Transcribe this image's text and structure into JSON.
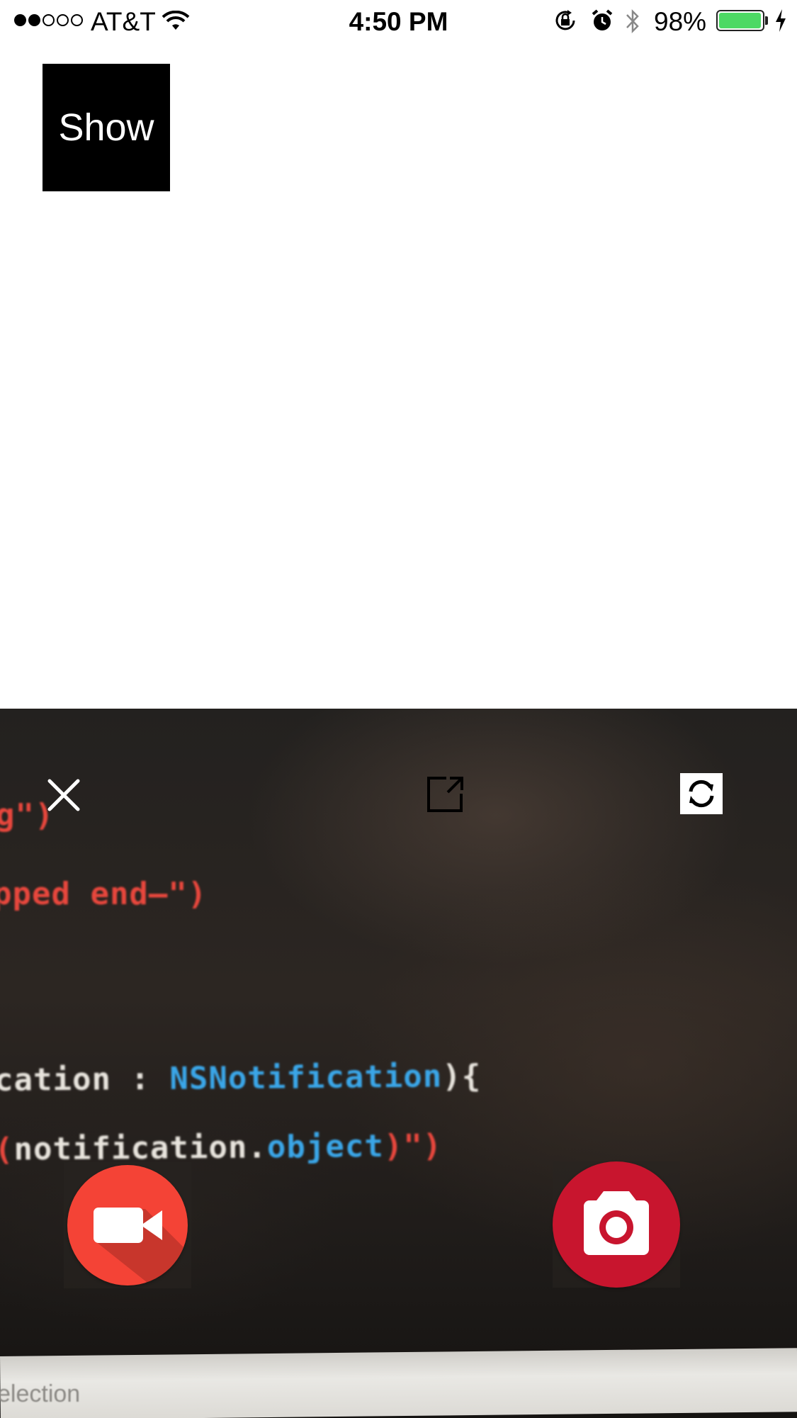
{
  "status_bar": {
    "carrier": "AT&T",
    "time": "4:50 PM",
    "battery_percent": "98%",
    "battery_level": 0.98,
    "signal_bars_filled": 2,
    "signal_bars_total": 5,
    "icons": [
      "signal-dots-icon",
      "wifi-icon",
      "rotation-lock-icon",
      "alarm-icon",
      "bluetooth-icon",
      "battery-icon",
      "charging-bolt-icon"
    ],
    "battery_color": "#4cd964"
  },
  "main": {
    "show_button_label": "Show"
  },
  "camera": {
    "controls": {
      "close_icon": "close-icon",
      "expand_icon": "expand-icon",
      "switch_icon": "switch-camera-icon",
      "video_icon": "video-camera-icon",
      "photo_icon": "photo-camera-icon"
    },
    "colors": {
      "video_button": "#f44336",
      "photo_button": "#c8152e"
    },
    "preview_text": {
      "line1": "g\")",
      "line2": "pped end—\")",
      "line3_a": "cation : ",
      "line3_b": "NSNotification",
      "line3_c": "){",
      "line4_a": "(",
      "line4_b": "notification.",
      "line4_c": "object",
      "line4_d": ")\")",
      "desk_label": "election"
    }
  }
}
